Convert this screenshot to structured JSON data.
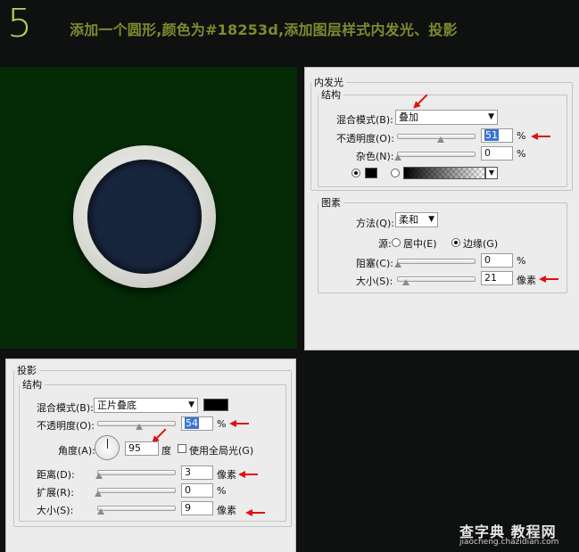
{
  "step": "5",
  "instruction": "添加一个圆形,颜色为#18253d,添加图层样式内发光、投影",
  "circle_color": "#18253d",
  "canvas_bg": "#042a06",
  "accent_arrow": "#e01010",
  "inner_glow": {
    "title": "内发光",
    "structure": {
      "legend": "结构",
      "blend_mode_label": "混合模式(B):",
      "blend_mode_value": "叠加",
      "opacity_label": "不透明度(O):",
      "opacity_value": "51",
      "opacity_unit": "%",
      "noise_label": "杂色(N):",
      "noise_value": "0",
      "noise_unit": "%",
      "opacity_fraction": 0.56,
      "noise_fraction": 0.0
    },
    "elements": {
      "legend": "图素",
      "technique_label": "方法(Q):",
      "technique_value": "柔和",
      "source_label": "源:",
      "source_center": "居中(E)",
      "source_edge": "边缘(G)",
      "choke_label": "阻塞(C):",
      "choke_value": "0",
      "choke_unit": "%",
      "size_label": "大小(S):",
      "size_value": "21",
      "size_unit": "像素",
      "choke_fraction": 0.0,
      "size_fraction": 0.1
    }
  },
  "drop_shadow": {
    "title": "投影",
    "structure": {
      "legend": "结构",
      "blend_mode_label": "混合模式(B):",
      "blend_mode_value": "正片叠底",
      "opacity_label": "不透明度(O):",
      "opacity_value": "54",
      "opacity_unit": "%",
      "angle_label": "角度(A):",
      "angle_value": "95",
      "angle_unit": "度",
      "global_light_label": "使用全局光(G)",
      "distance_label": "距离(D):",
      "distance_value": "3",
      "distance_unit": "像素",
      "spread_label": "扩展(R):",
      "spread_value": "0",
      "spread_unit": "%",
      "size_label": "大小(S):",
      "size_value": "9",
      "size_unit": "像素",
      "opacity_fraction": 0.54,
      "distance_fraction": 0.01,
      "spread_fraction": 0.0,
      "size_fraction": 0.04
    }
  },
  "watermark": {
    "title": "查字典 教程网",
    "url": "jiaocheng.chazidian.com"
  }
}
